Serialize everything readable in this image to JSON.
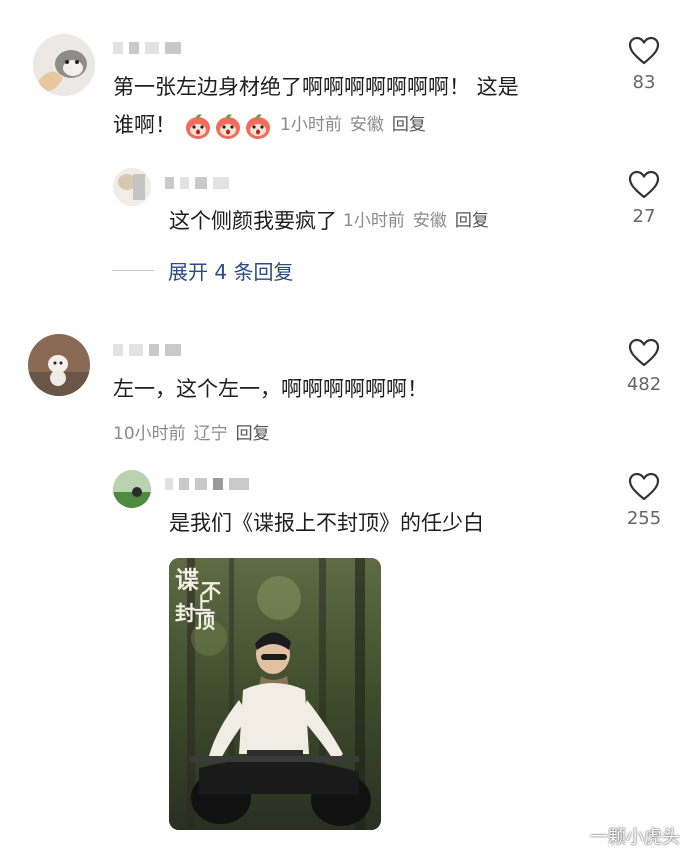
{
  "comments": [
    {
      "text_line1": "第一张左边身材绝了啊啊啊啊啊啊啊！ 这是",
      "text_line2": "谁啊！",
      "time": "1小时前",
      "location": "安徽",
      "reply": "回复",
      "likes": "83",
      "replies": [
        {
          "text": "这个侧颜我要疯了",
          "time": "1小时前",
          "location": "安徽",
          "reply": "回复",
          "likes": "27"
        }
      ],
      "expand_label": "展开 4 条回复"
    },
    {
      "text": "左一，这个左一，啊啊啊啊啊啊！",
      "time": "10小时前",
      "location": "辽宁",
      "reply": "回复",
      "likes": "482",
      "replies": [
        {
          "text": "是我们《谍报上不封顶》的任少白",
          "likes": "255",
          "poster_title": "谍报上不封顶"
        }
      ]
    }
  ],
  "watermark": "一颗小虎头",
  "colors": {
    "meta": "#8a8a8a",
    "expand": "#2c4a8a",
    "text": "#1e1e1e"
  },
  "icons": {
    "like": "heart-outline-icon",
    "emoji": "red-peach-emoji-icon",
    "watermark": "weibo-icon"
  }
}
